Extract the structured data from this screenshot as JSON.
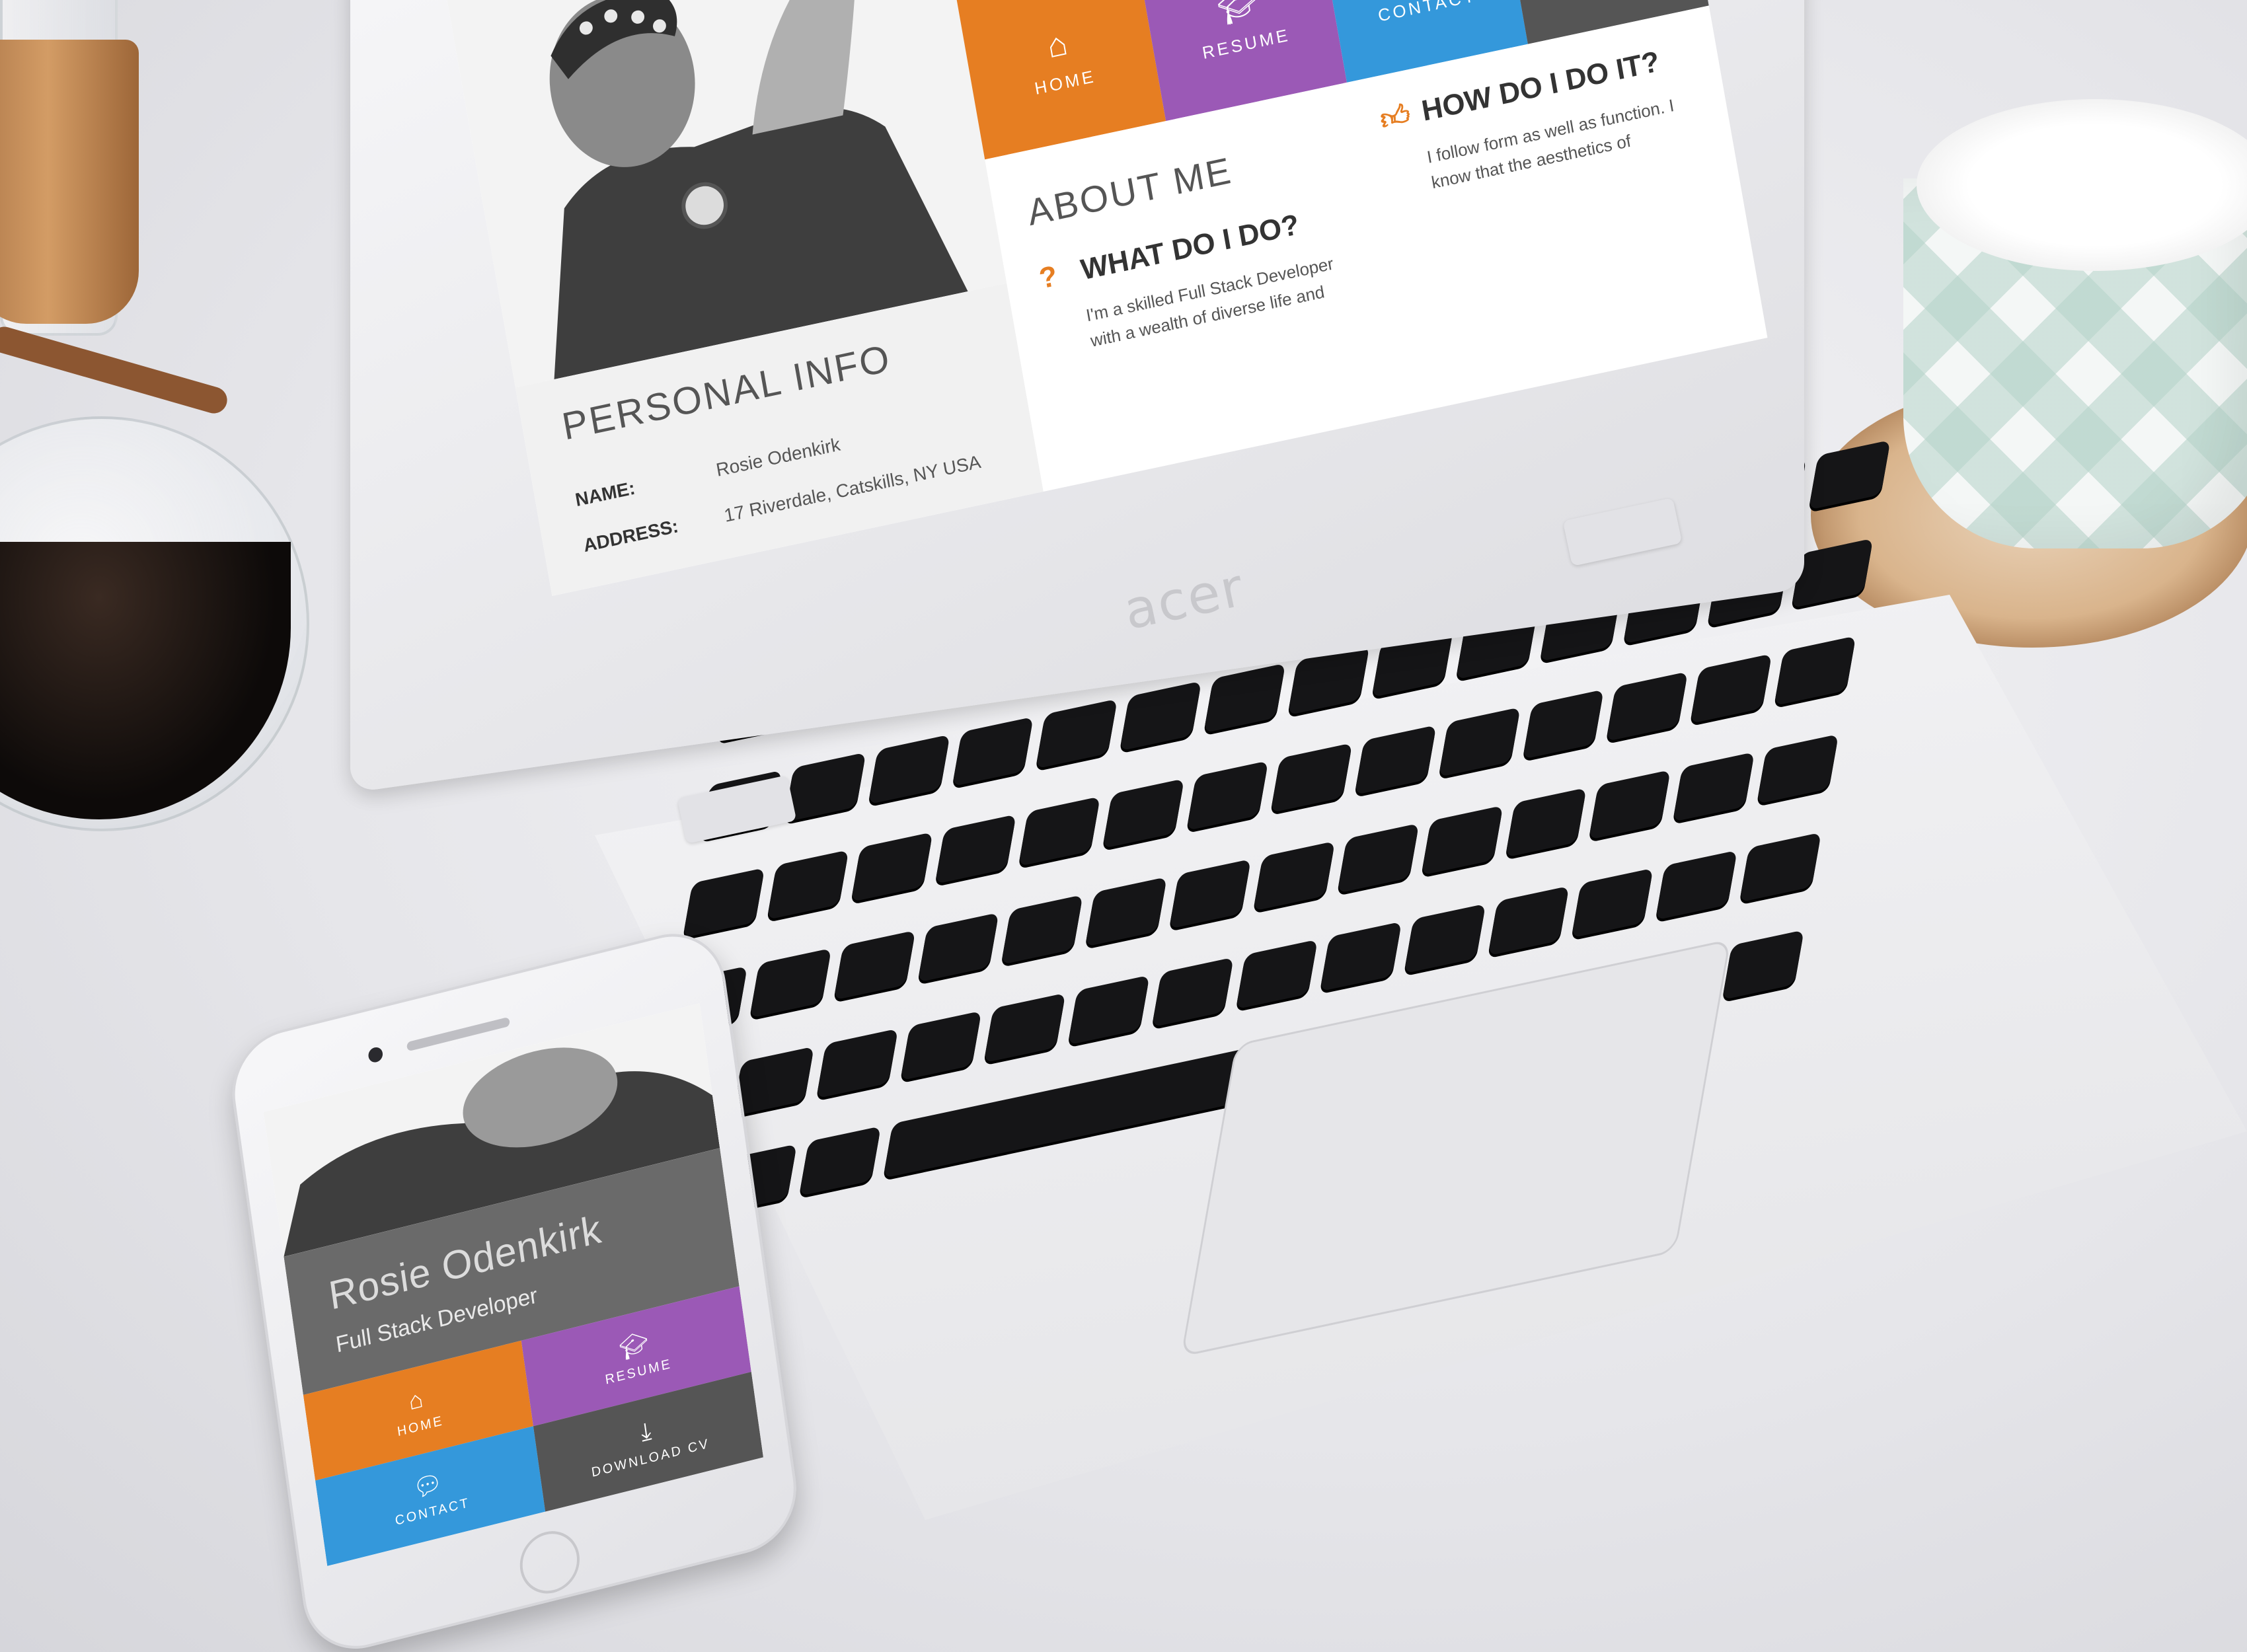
{
  "profile": {
    "name": "Rosie Odenkirk",
    "role": "Full Stack Developer"
  },
  "nav": {
    "home": {
      "label": "HOME",
      "icon": "home-icon",
      "color": "#e67e22"
    },
    "resume": {
      "label": "RESUME",
      "icon": "graduation-cap-icon",
      "color": "#9b59b6"
    },
    "contact": {
      "label": "CONTACT",
      "icon": "chat-bubble-icon",
      "color": "#3498db"
    },
    "download": {
      "label": "DOWNLOAD CV",
      "icon": "download-icon",
      "color": "#555555"
    }
  },
  "personal_info": {
    "title": "PERSONAL INFO",
    "name_label": "NAME:",
    "name_value": "Rosie Odenkirk",
    "address_label": "ADDRESS:",
    "address_value": "17 Riverdale, Catskills, NY USA"
  },
  "about": {
    "title": "ABOUT ME",
    "what": {
      "heading": "WHAT DO I DO?",
      "icon": "question-icon",
      "text": "I'm a skilled Full Stack Developer with a wealth of diverse life and"
    },
    "how": {
      "heading": "HOW DO I DO IT?",
      "icon": "thumbs-up-icon",
      "text": "I follow form as well as function. I know that the aesthetics of"
    }
  },
  "laptop_brand": "acer",
  "colors": {
    "header_gray": "#6a6a6a",
    "accent_orange": "#e67e22",
    "accent_purple": "#9b59b6",
    "accent_blue": "#3498db",
    "dark_tile": "#555555"
  }
}
